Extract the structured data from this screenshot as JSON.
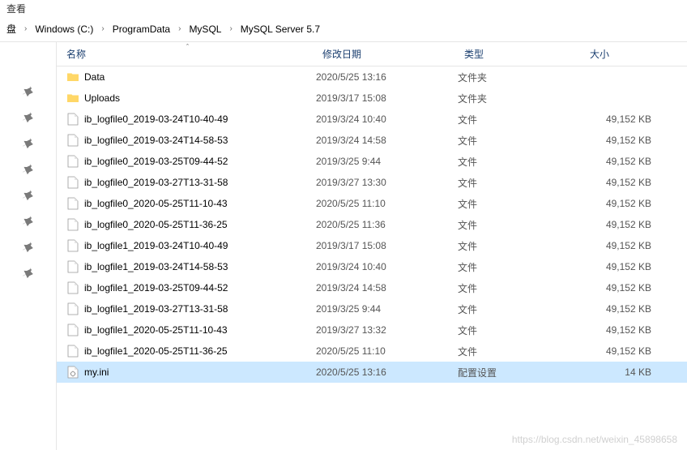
{
  "topbar_text": "查看",
  "breadcrumb": [
    {
      "label": "盘",
      "back": true
    },
    {
      "label": "Windows (C:)"
    },
    {
      "label": "ProgramData"
    },
    {
      "label": "MySQL"
    },
    {
      "label": "MySQL Server 5.7"
    }
  ],
  "columns": {
    "name": "名称",
    "date": "修改日期",
    "type": "类型",
    "size": "大小"
  },
  "files": [
    {
      "name": "Data",
      "date": "2020/5/25 13:16",
      "type": "文件夹",
      "size": "",
      "kind": "folder",
      "selected": false
    },
    {
      "name": "Uploads",
      "date": "2019/3/17 15:08",
      "type": "文件夹",
      "size": "",
      "kind": "folder",
      "selected": false
    },
    {
      "name": "ib_logfile0_2019-03-24T10-40-49",
      "date": "2019/3/24 10:40",
      "type": "文件",
      "size": "49,152 KB",
      "kind": "file",
      "selected": false
    },
    {
      "name": "ib_logfile0_2019-03-24T14-58-53",
      "date": "2019/3/24 14:58",
      "type": "文件",
      "size": "49,152 KB",
      "kind": "file",
      "selected": false
    },
    {
      "name": "ib_logfile0_2019-03-25T09-44-52",
      "date": "2019/3/25 9:44",
      "type": "文件",
      "size": "49,152 KB",
      "kind": "file",
      "selected": false
    },
    {
      "name": "ib_logfile0_2019-03-27T13-31-58",
      "date": "2019/3/27 13:30",
      "type": "文件",
      "size": "49,152 KB",
      "kind": "file",
      "selected": false
    },
    {
      "name": "ib_logfile0_2020-05-25T11-10-43",
      "date": "2020/5/25 11:10",
      "type": "文件",
      "size": "49,152 KB",
      "kind": "file",
      "selected": false
    },
    {
      "name": "ib_logfile0_2020-05-25T11-36-25",
      "date": "2020/5/25 11:36",
      "type": "文件",
      "size": "49,152 KB",
      "kind": "file",
      "selected": false
    },
    {
      "name": "ib_logfile1_2019-03-24T10-40-49",
      "date": "2019/3/17 15:08",
      "type": "文件",
      "size": "49,152 KB",
      "kind": "file",
      "selected": false
    },
    {
      "name": "ib_logfile1_2019-03-24T14-58-53",
      "date": "2019/3/24 10:40",
      "type": "文件",
      "size": "49,152 KB",
      "kind": "file",
      "selected": false
    },
    {
      "name": "ib_logfile1_2019-03-25T09-44-52",
      "date": "2019/3/24 14:58",
      "type": "文件",
      "size": "49,152 KB",
      "kind": "file",
      "selected": false
    },
    {
      "name": "ib_logfile1_2019-03-27T13-31-58",
      "date": "2019/3/25 9:44",
      "type": "文件",
      "size": "49,152 KB",
      "kind": "file",
      "selected": false
    },
    {
      "name": "ib_logfile1_2020-05-25T11-10-43",
      "date": "2019/3/27 13:32",
      "type": "文件",
      "size": "49,152 KB",
      "kind": "file",
      "selected": false
    },
    {
      "name": "ib_logfile1_2020-05-25T11-36-25",
      "date": "2020/5/25 11:10",
      "type": "文件",
      "size": "49,152 KB",
      "kind": "file",
      "selected": false
    },
    {
      "name": "my.ini",
      "date": "2020/5/25 13:16",
      "type": "配置设置",
      "size": "14 KB",
      "kind": "ini",
      "selected": true
    }
  ],
  "pin_count": 8,
  "watermark": "https://blog.csdn.net/weixin_45898658"
}
